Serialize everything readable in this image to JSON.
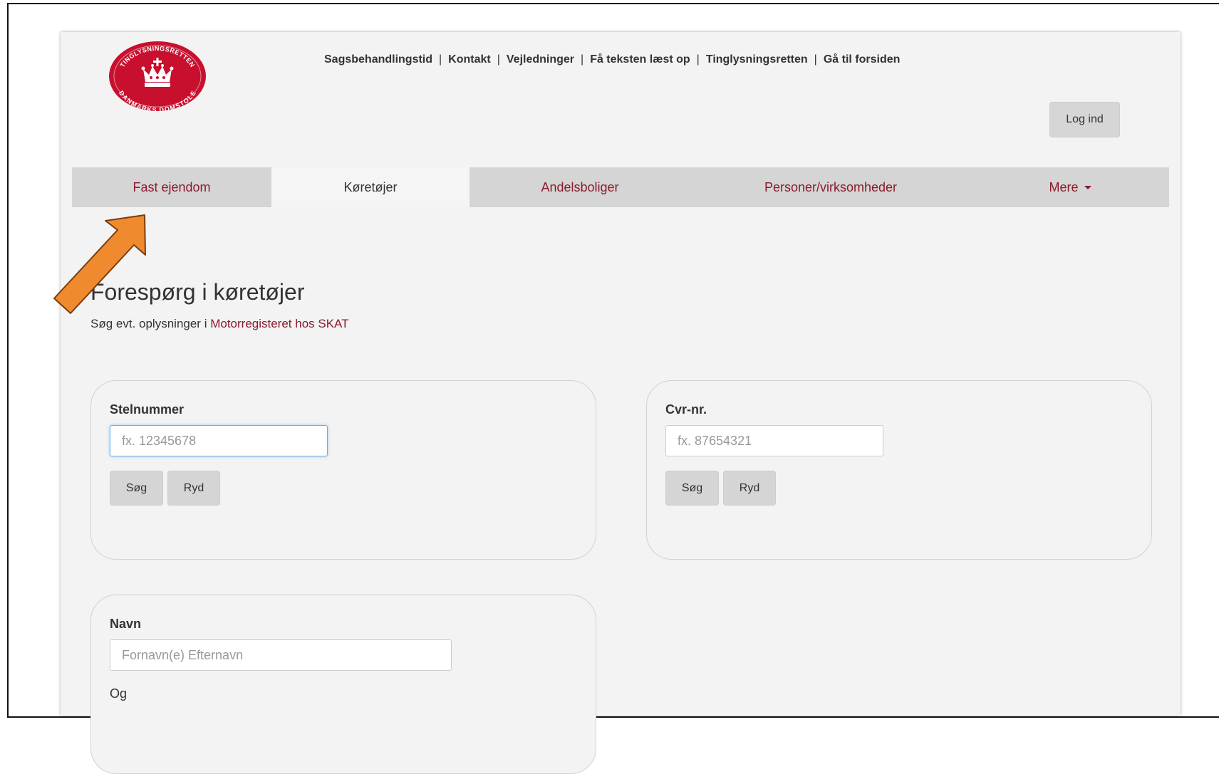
{
  "header": {
    "logo": {
      "arc_top": "TINGLYSNINGSRETTEN",
      "arc_bottom": "DANMARKS DOMSTOLE",
      "color": "#c8102e"
    },
    "topnav": [
      {
        "label": "Sagsbehandlingstid"
      },
      {
        "label": "Kontakt"
      },
      {
        "label": "Vejledninger"
      },
      {
        "label": "Få teksten læst op"
      },
      {
        "label": "Tinglysningsretten"
      },
      {
        "label": "Gå til forsiden"
      }
    ],
    "separator": "|",
    "login_label": "Log ind"
  },
  "tabs": [
    {
      "label": "Fast ejendom",
      "active": false
    },
    {
      "label": "Køretøjer",
      "active": true
    },
    {
      "label": "Andelsboliger",
      "active": false
    },
    {
      "label": "Personer/virksomheder",
      "active": false
    },
    {
      "label": "Mere",
      "active": false,
      "icon": "caret-down-icon"
    }
  ],
  "page": {
    "title": "Forespørg i køretøjer",
    "subtitle_text": "Søg evt. oplysninger i ",
    "subtitle_link": "Motorregisteret hos SKAT"
  },
  "forms": {
    "stelnummer": {
      "label": "Stelnummer",
      "value": "",
      "placeholder": "fx. 12345678",
      "search_label": "Søg",
      "clear_label": "Ryd"
    },
    "cvr": {
      "label": "Cvr-nr.",
      "value": "",
      "placeholder": "fx. 87654321",
      "search_label": "Søg",
      "clear_label": "Ryd"
    },
    "navn": {
      "label": "Navn",
      "value": "",
      "placeholder": "Fornavn(e) Efternavn",
      "og_label": "Og"
    }
  },
  "annotation": {
    "icon": "arrow-icon",
    "color": "#f08a2e"
  },
  "colors": {
    "brand": "#8b1a2a",
    "tab_bar": "#d5d5d5",
    "page_bg": "#f3f3f3"
  }
}
